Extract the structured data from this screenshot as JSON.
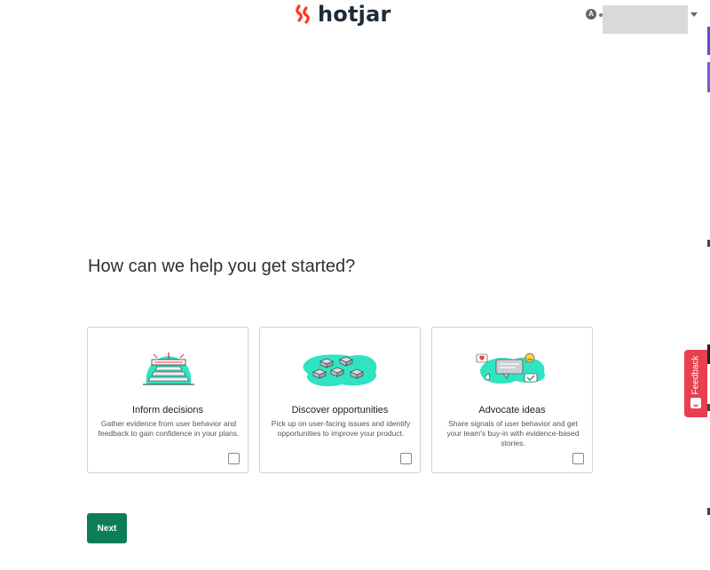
{
  "header": {
    "logo_text": "hotjar",
    "account_initial": "A"
  },
  "feedback": {
    "label": "Feedback"
  },
  "main": {
    "question": "How can we help you get started?",
    "cards": [
      {
        "title": "Inform decisions",
        "description": "Gather evidence from user behavior and feedback to gain confidence in your plans.",
        "checked": false
      },
      {
        "title": "Discover opportunities",
        "description": "Pick up on user-facing issues and identify opportunities to improve your product.",
        "checked": false
      },
      {
        "title": "Advocate ideas",
        "description": "Share signals of user behavior and get your team's buy-in with evidence-based stories.",
        "checked": false
      }
    ],
    "next_label": "Next"
  },
  "colors": {
    "brand_orange": "#fd3a1f",
    "primary_green": "#0e7d55",
    "illustration_teal": "#30e3c1",
    "feedback_red": "#e8404e"
  }
}
